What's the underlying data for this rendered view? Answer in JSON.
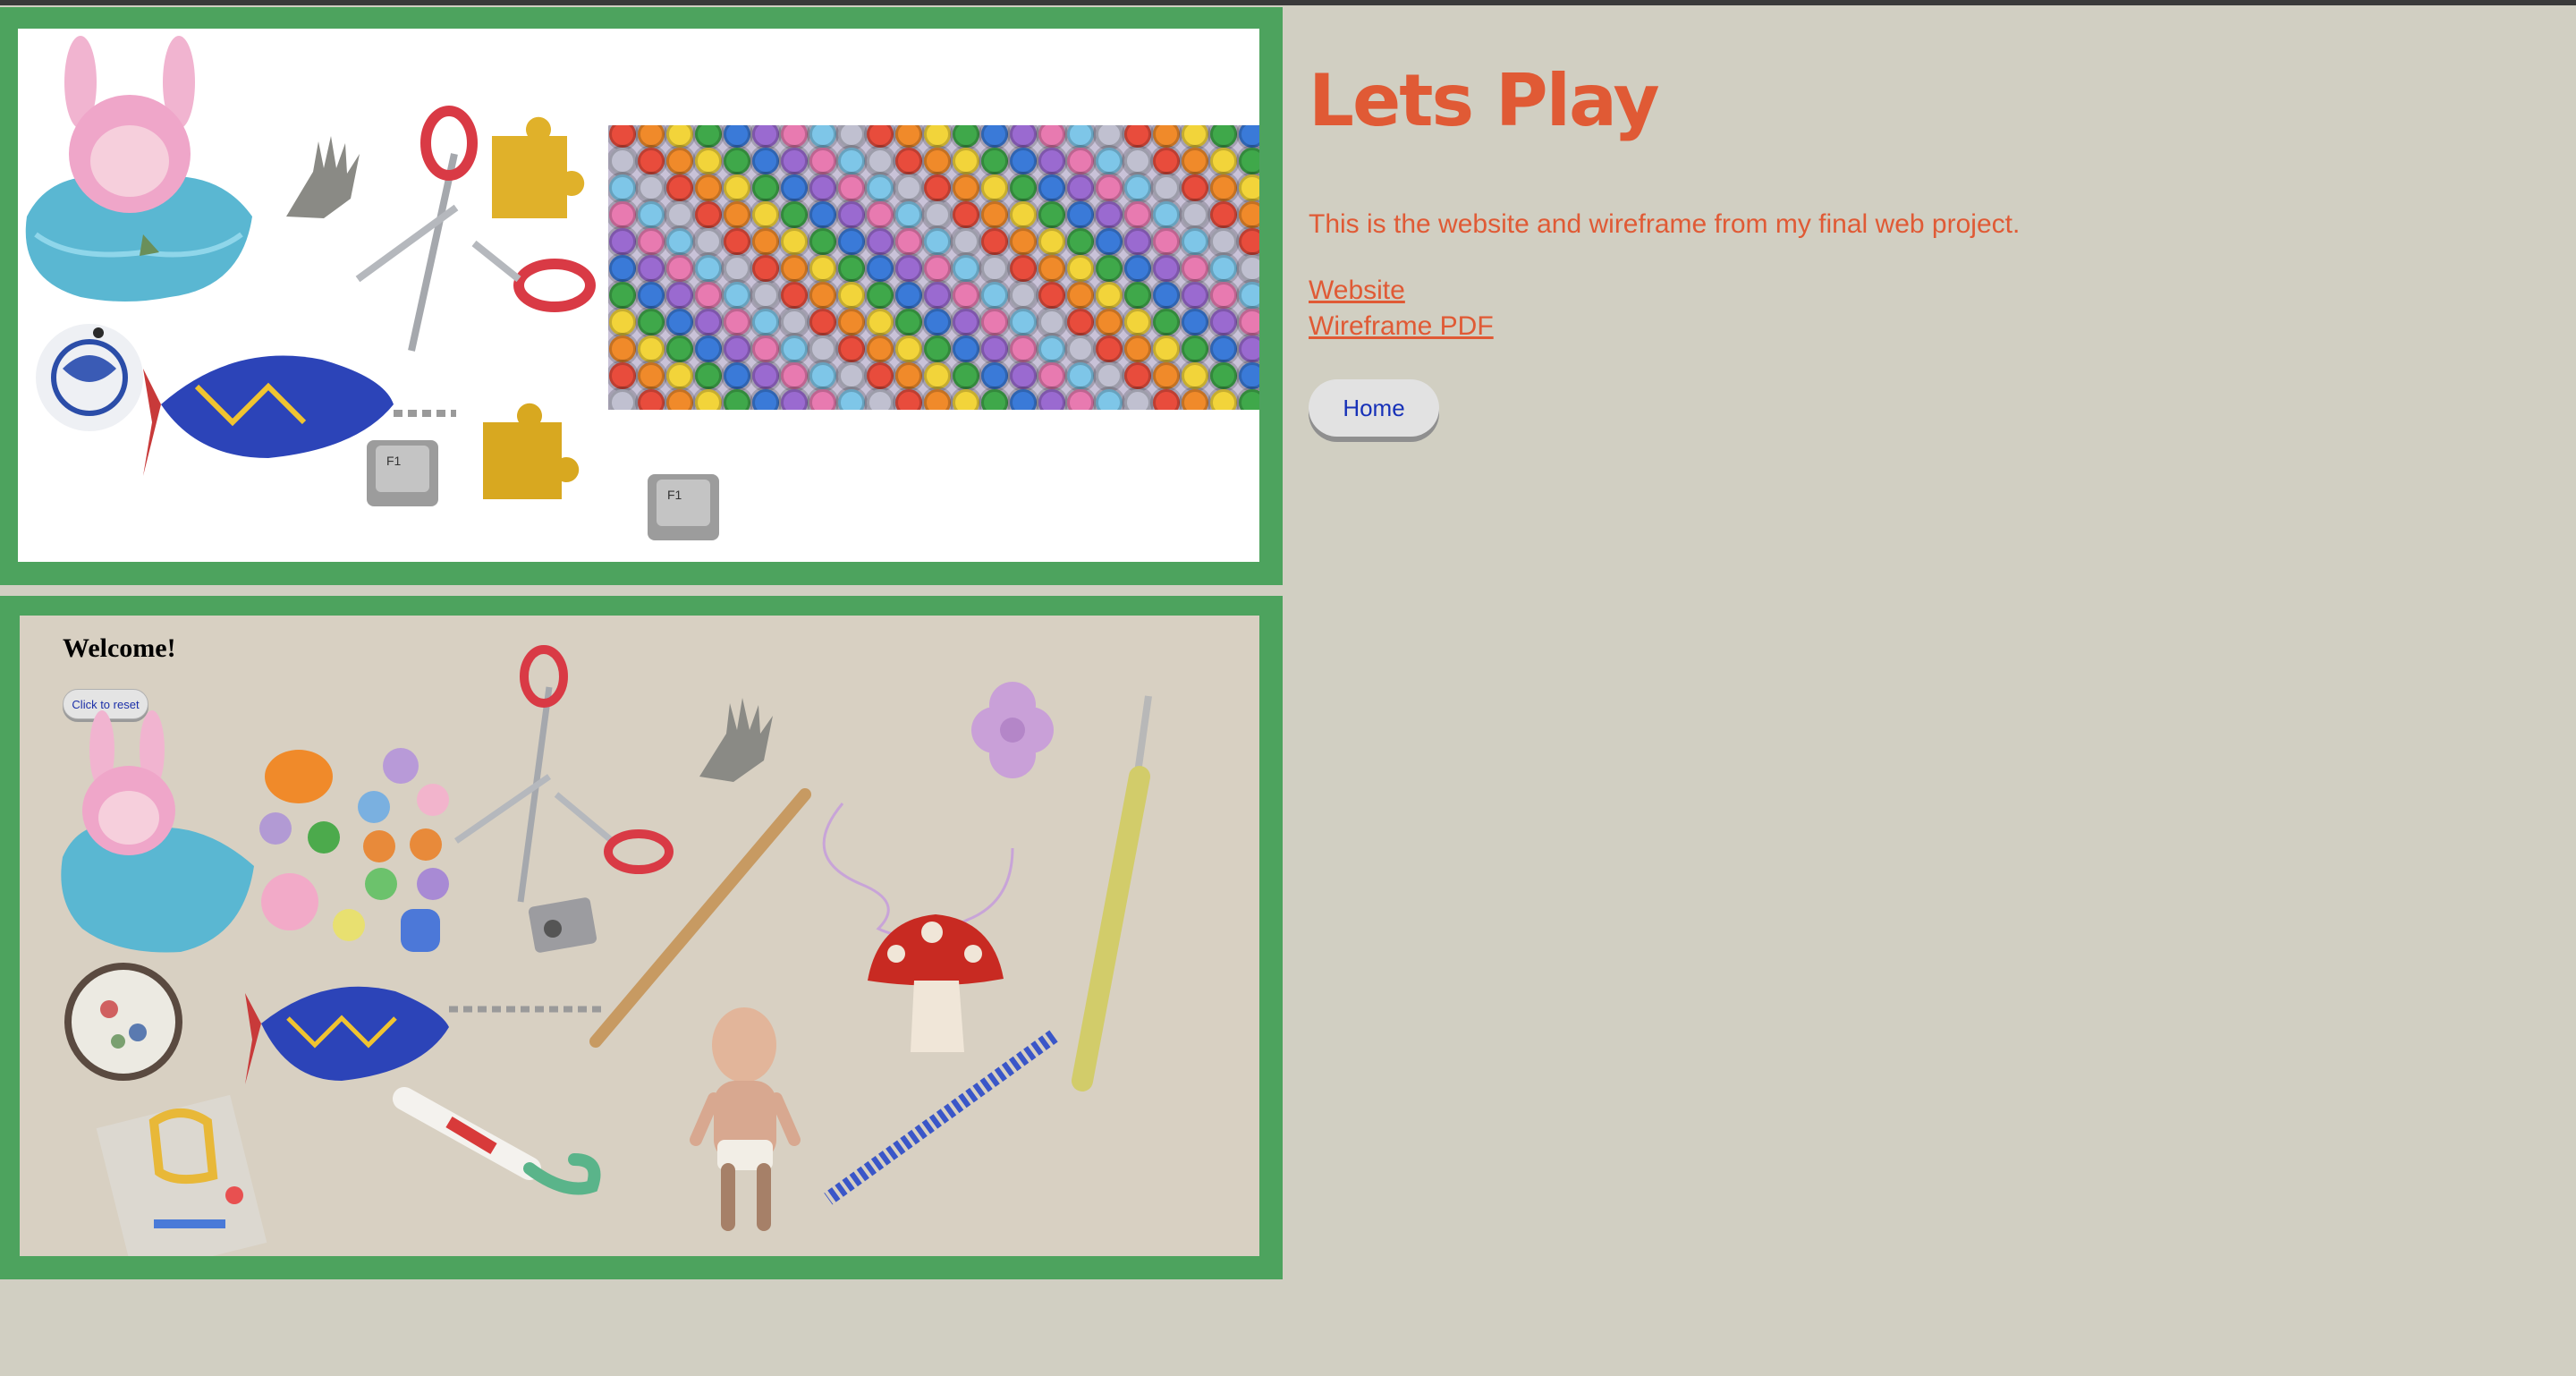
{
  "info": {
    "title": "Lets Play",
    "description": "This is the website and wireframe from my final web project.",
    "links": [
      "Website",
      "Wireframe PDF"
    ],
    "home_button": "Home"
  },
  "preview": {
    "welcome_title": "Welcome!",
    "reset_button": "Click to reset",
    "key_label": "F1"
  },
  "colors": {
    "background": "#d1cfc2",
    "frame_green": "#4da35e",
    "accent_orange": "#e05a35",
    "button_text_blue": "#1731b8"
  }
}
